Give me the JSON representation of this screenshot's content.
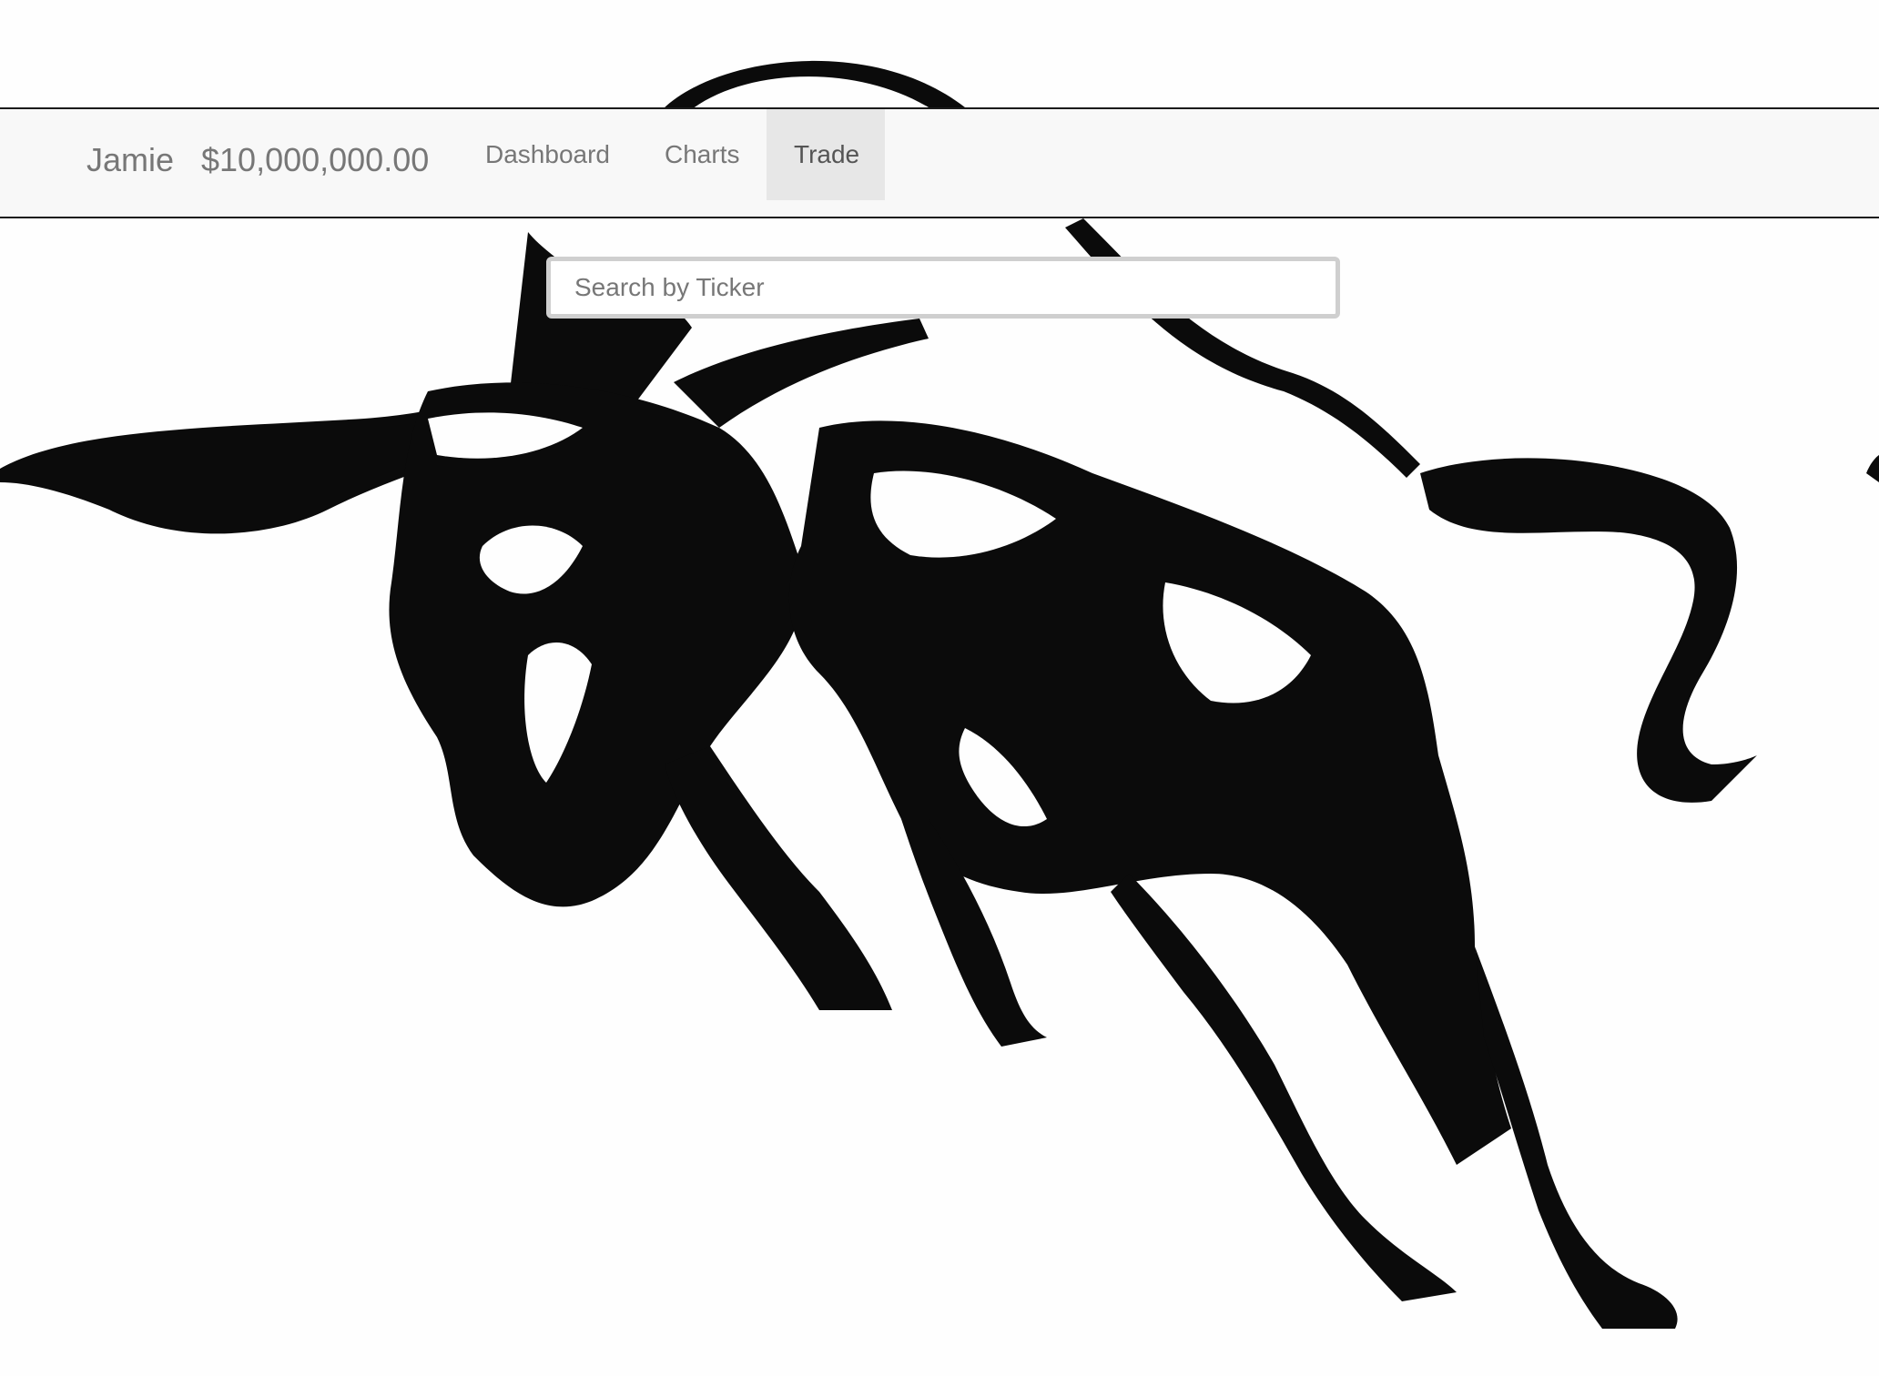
{
  "navbar": {
    "user_name": "Jamie",
    "balance": "$10,000,000.00",
    "items": [
      {
        "label": "Dashboard",
        "active": false
      },
      {
        "label": "Charts",
        "active": false
      },
      {
        "label": "Trade",
        "active": true
      }
    ]
  },
  "search": {
    "placeholder": "Search by Ticker",
    "value": ""
  },
  "background": {
    "image": "charging-bull-icon",
    "colors": {
      "ink": "#0b0b0b",
      "paper": "#fefefe"
    }
  },
  "colors": {
    "navbar_bg": "#f8f8f8",
    "nav_text": "#777777",
    "nav_active_bg": "#e7e7e7"
  }
}
